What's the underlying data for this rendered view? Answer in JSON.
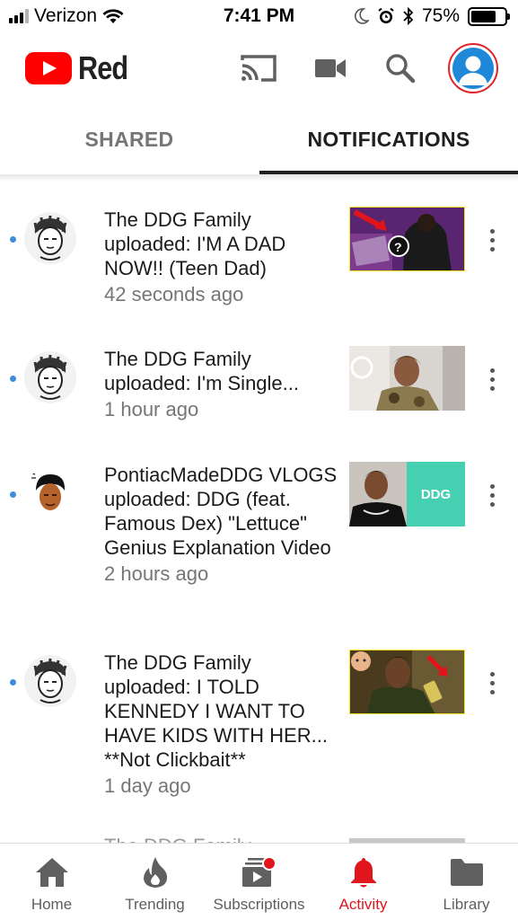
{
  "status_bar": {
    "carrier": "Verizon",
    "time": "7:41 PM",
    "battery": "75%",
    "battery_level": 0.75
  },
  "header": {
    "logo_text": "Red",
    "icons": [
      "cast-icon",
      "camera-icon",
      "search-icon",
      "account-avatar"
    ]
  },
  "tabs": {
    "shared": "SHARED",
    "notifications": "NOTIFICATIONS",
    "active": "notifications"
  },
  "notifications": [
    {
      "channel": "The DDG Family",
      "text": "The DDG Family uploaded: I'M A DAD NOW!! (Teen Dad)",
      "time": "42 seconds ago",
      "unread": true
    },
    {
      "channel": "The DDG Family",
      "text": "The DDG Family uploaded: I'm Single...",
      "time": "1 hour ago",
      "unread": true
    },
    {
      "channel": "PontiacMadeDDG VLOGS",
      "text": "PontiacMadeDDG VLOGS uploaded: DDG (feat. Famous Dex) \"Lettuce\" Genius Explanation Video",
      "time": "2 hours ago",
      "unread": true,
      "thumb_badge": "DDG"
    },
    {
      "channel": "The DDG Family",
      "text": "The DDG Family uploaded: I TOLD KENNEDY I WANT TO HAVE KIDS WITH HER... **Not Clickbait**",
      "time": "1 day ago",
      "unread": true
    }
  ],
  "partial_item_text": "The DDG Family",
  "bottom_nav": [
    {
      "label": "Home",
      "icon": "home-icon"
    },
    {
      "label": "Trending",
      "icon": "flame-icon"
    },
    {
      "label": "Subscriptions",
      "icon": "subscriptions-icon"
    },
    {
      "label": "Activity",
      "icon": "bell-icon",
      "active": true
    },
    {
      "label": "Library",
      "icon": "folder-icon"
    }
  ],
  "colors": {
    "brand_red": "#ff0000",
    "active_red": "#e1161d",
    "unread_blue": "#3d8de0",
    "text_secondary": "#767676"
  }
}
